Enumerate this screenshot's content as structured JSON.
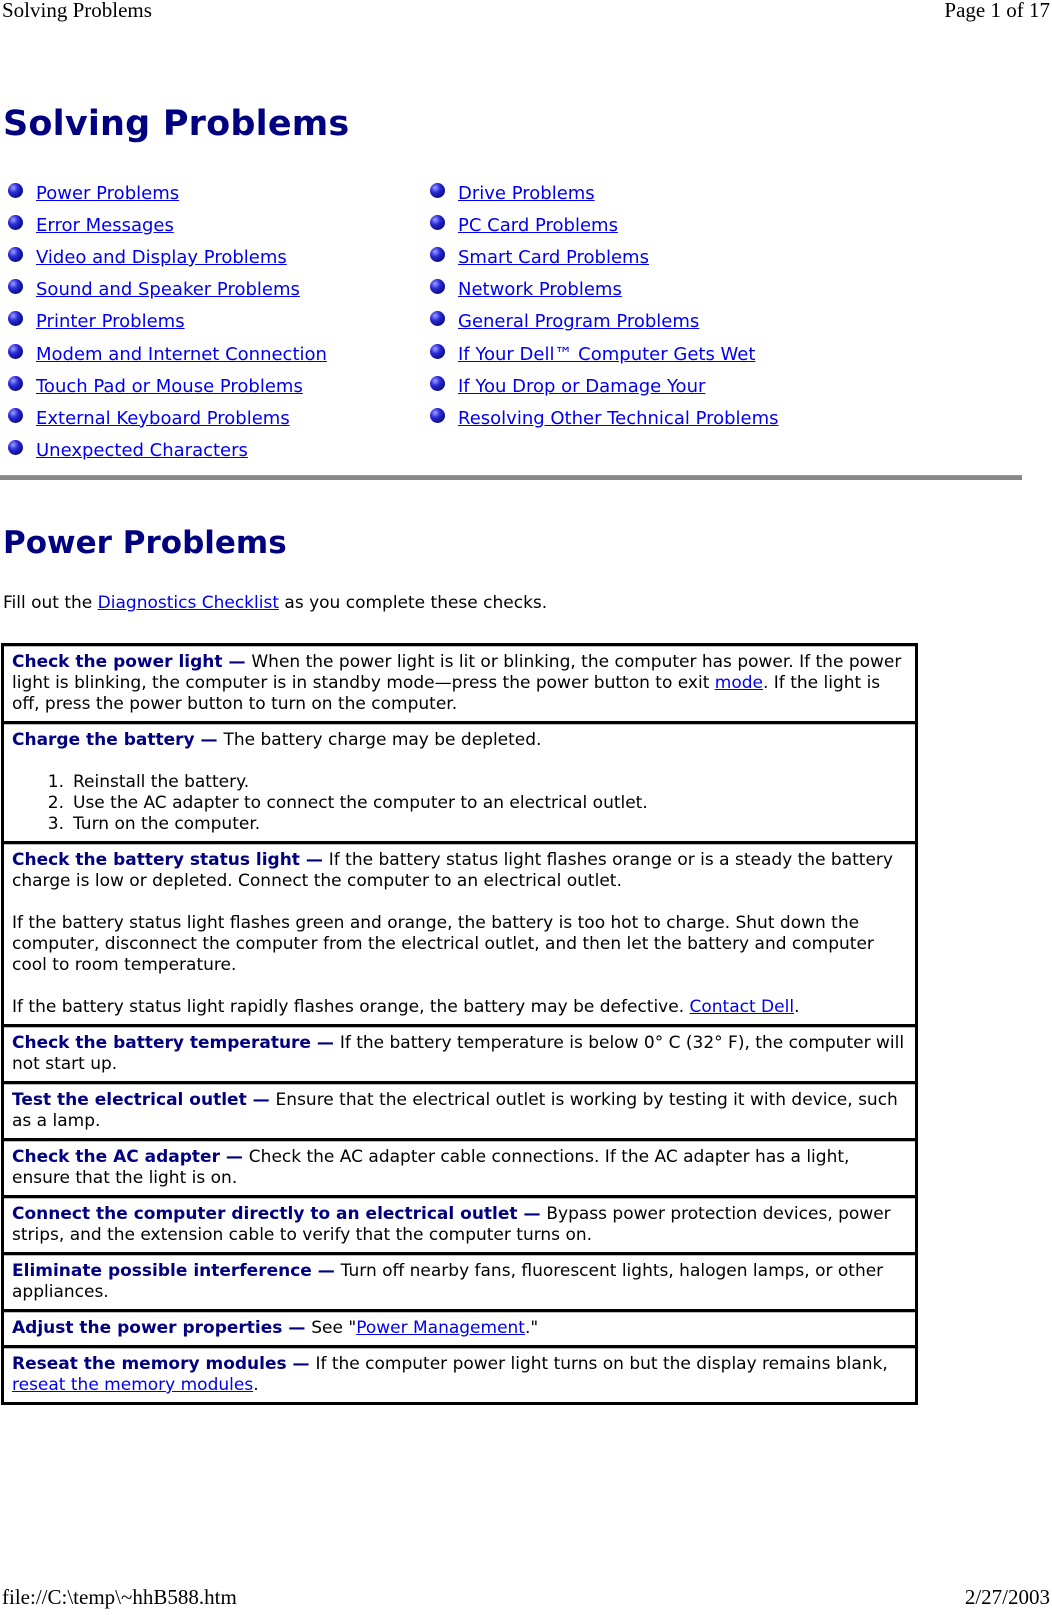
{
  "print_header": {
    "left": "Solving Problems",
    "right": "Page 1 of 17"
  },
  "print_footer": {
    "left": "file://C:\\temp\\~hhB588.htm",
    "right": "2/27/2003"
  },
  "page_title": "Solving Problems",
  "toc": {
    "left": [
      "Power Problems",
      "Error Messages",
      "Video and Display Problems",
      "Sound and Speaker Problems",
      "Printer Problems",
      "Modem and Internet Connection",
      "Touch Pad or Mouse Problems",
      "External Keyboard Problems",
      "Unexpected Characters"
    ],
    "right": [
      "Drive Problems",
      "PC Card Problems",
      "Smart Card Problems",
      "Network Problems",
      "General Program Problems",
      "If Your Dell™ Computer Gets Wet",
      "If You Drop or Damage Your",
      "Resolving Other Technical Problems"
    ]
  },
  "section": {
    "title": "Power Problems",
    "intro_before": "Fill out the ",
    "intro_link": "Diagnostics Checklist",
    "intro_after": " as you complete these checks."
  },
  "checks": {
    "power_light": {
      "term": "Check the power light — ",
      "text_before": "When the power light is lit or blinking, the computer has power. If the power light is blinking, the computer is in standby mode—press the power button to exit ",
      "link": "mode",
      "text_after": ". If the light is off, press the power button to turn on the computer."
    },
    "charge_battery": {
      "term": "Charge the battery — ",
      "text": "The battery charge may be depleted.",
      "steps": [
        {
          "num": "1.",
          "text": "Reinstall the battery."
        },
        {
          "num": "2.",
          "text": "Use the AC adapter to connect the computer to an electrical outlet."
        },
        {
          "num": "3.",
          "text": "Turn on the computer."
        }
      ]
    },
    "battery_status": {
      "term": "Check the battery status light — ",
      "text": "If the battery status light flashes orange or is a steady the battery charge is low or depleted. Connect the computer to an electrical outlet.",
      "para2": "If the battery status light flashes green and orange, the battery is too hot to charge. Shut down the computer, disconnect the computer from the electrical outlet, and then let the battery and computer cool to room temperature.",
      "para3_before": "If the battery status light rapidly flashes orange, the battery may be defective. ",
      "para3_link": "Contact Dell",
      "para3_after": "."
    },
    "battery_temp": {
      "term": "Check the battery temperature — ",
      "text": "If the battery temperature is below 0° C (32° F), the computer will not start up."
    },
    "outlet": {
      "term": "Test the electrical outlet — ",
      "text": "Ensure that the electrical outlet is working by testing it with device, such as a lamp."
    },
    "ac_adapter": {
      "term": "Check the AC adapter — ",
      "text": "Check the AC adapter cable connections. If the AC adapter has a light, ensure that the light is on."
    },
    "direct": {
      "term": "Connect the computer directly to an electrical outlet — ",
      "text": "Bypass power protection devices, power strips, and the extension cable to verify that the computer turns on."
    },
    "interference": {
      "term": "Eliminate possible interference — ",
      "text": "Turn off nearby fans, fluorescent lights, halogen lamps, or other appliances."
    },
    "power_props": {
      "term": "Adjust the power properties — ",
      "text_before": "See \"",
      "link": "Power Management",
      "text_after": ".\""
    },
    "memory": {
      "term": "Reseat the memory modules — ",
      "text_before": "If the computer power light turns on but the display remains blank, ",
      "link": "reseat the memory modules",
      "text_after": "."
    }
  },
  "colors": {
    "heading": "#000080",
    "link": "#0000ee",
    "rule": "#888888"
  }
}
